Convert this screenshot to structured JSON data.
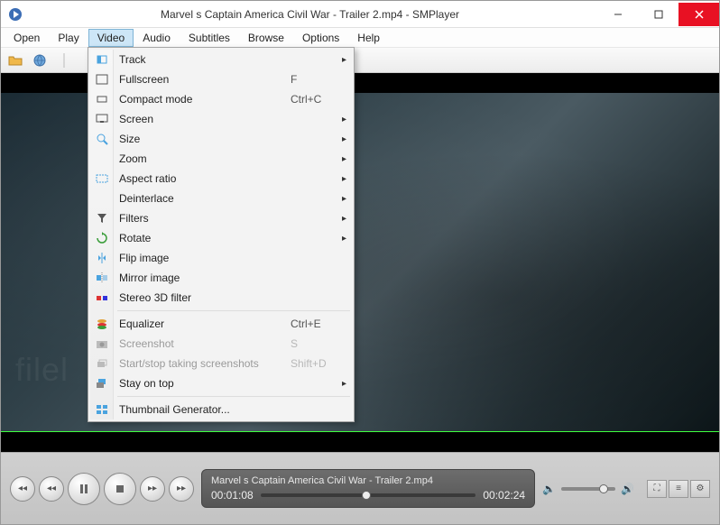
{
  "window": {
    "title": "Marvel s Captain America  Civil War - Trailer 2.mp4 - SMPlayer"
  },
  "menubar": [
    "Open",
    "Play",
    "Video",
    "Audio",
    "Subtitles",
    "Browse",
    "Options",
    "Help"
  ],
  "active_menu_index": 2,
  "dropdown": {
    "items": [
      {
        "icon": "track",
        "label": "Track",
        "shortcut": "",
        "submenu": true,
        "disabled": false
      },
      {
        "icon": "fullscreen",
        "label": "Fullscreen",
        "shortcut": "F",
        "submenu": false,
        "disabled": false
      },
      {
        "icon": "compact",
        "label": "Compact mode",
        "shortcut": "Ctrl+C",
        "submenu": false,
        "disabled": false
      },
      {
        "icon": "screen",
        "label": "Screen",
        "shortcut": "",
        "submenu": true,
        "disabled": false
      },
      {
        "icon": "size",
        "label": "Size",
        "shortcut": "",
        "submenu": true,
        "disabled": false
      },
      {
        "icon": "zoom",
        "label": "Zoom",
        "shortcut": "",
        "submenu": true,
        "disabled": false
      },
      {
        "icon": "aspect",
        "label": "Aspect ratio",
        "shortcut": "",
        "submenu": true,
        "disabled": false
      },
      {
        "icon": "deint",
        "label": "Deinterlace",
        "shortcut": "",
        "submenu": true,
        "disabled": false
      },
      {
        "icon": "filters",
        "label": "Filters",
        "shortcut": "",
        "submenu": true,
        "disabled": false
      },
      {
        "icon": "rotate",
        "label": "Rotate",
        "shortcut": "",
        "submenu": true,
        "disabled": false
      },
      {
        "icon": "flip",
        "label": "Flip image",
        "shortcut": "",
        "submenu": false,
        "disabled": false
      },
      {
        "icon": "mirror",
        "label": "Mirror image",
        "shortcut": "",
        "submenu": false,
        "disabled": false
      },
      {
        "icon": "stereo",
        "label": "Stereo 3D filter",
        "shortcut": "",
        "submenu": false,
        "disabled": false
      },
      {
        "sep": true
      },
      {
        "icon": "equalizer",
        "label": "Equalizer",
        "shortcut": "Ctrl+E",
        "submenu": false,
        "disabled": false
      },
      {
        "icon": "camera",
        "label": "Screenshot",
        "shortcut": "S",
        "submenu": false,
        "disabled": true
      },
      {
        "icon": "burst",
        "label": "Start/stop taking screenshots",
        "shortcut": "Shift+D",
        "submenu": false,
        "disabled": true
      },
      {
        "icon": "ontop",
        "label": "Stay on top",
        "shortcut": "",
        "submenu": true,
        "disabled": false
      },
      {
        "sep": true
      },
      {
        "icon": "thumb",
        "label": "Thumbnail Generator...",
        "shortcut": "",
        "submenu": false,
        "disabled": false
      }
    ]
  },
  "playback": {
    "title": "Marvel s Captain America  Civil War - Trailer 2.mp4",
    "position": "00:01:08",
    "duration": "00:02:24"
  },
  "watermark": "filel"
}
